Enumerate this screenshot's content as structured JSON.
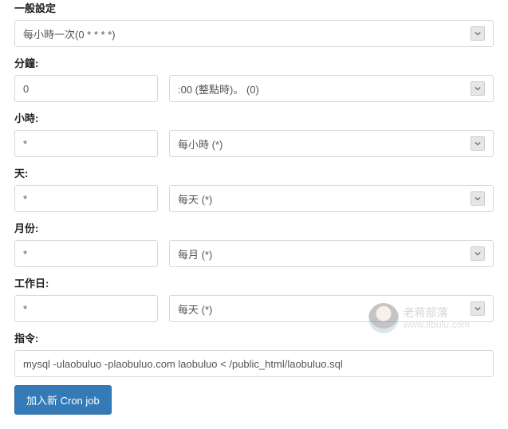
{
  "labels": {
    "general": "一般設定",
    "minute": "分鐘:",
    "hour": "小時:",
    "day": "天:",
    "month": "月份:",
    "weekday": "工作日:",
    "command": "指令:"
  },
  "fields": {
    "general_select": "每小時一次(0 * * * *)",
    "minute_value": "0",
    "minute_select": ":00 (整點時)。  (0)",
    "hour_value": "*",
    "hour_select": "每小時 (*)",
    "day_value": "*",
    "day_select": "每天 (*)",
    "month_value": "*",
    "month_select": "每月 (*)",
    "weekday_value": "*",
    "weekday_select": "每天 (*)",
    "command_value": "mysql -ulaobuluo -plaobuluo.com laobuluo < /public_html/laobuluo.sql"
  },
  "button": {
    "submit": "加入新 Cron job"
  },
  "watermark": {
    "title": "老蒋部落",
    "url": "www.itbulu.com"
  }
}
